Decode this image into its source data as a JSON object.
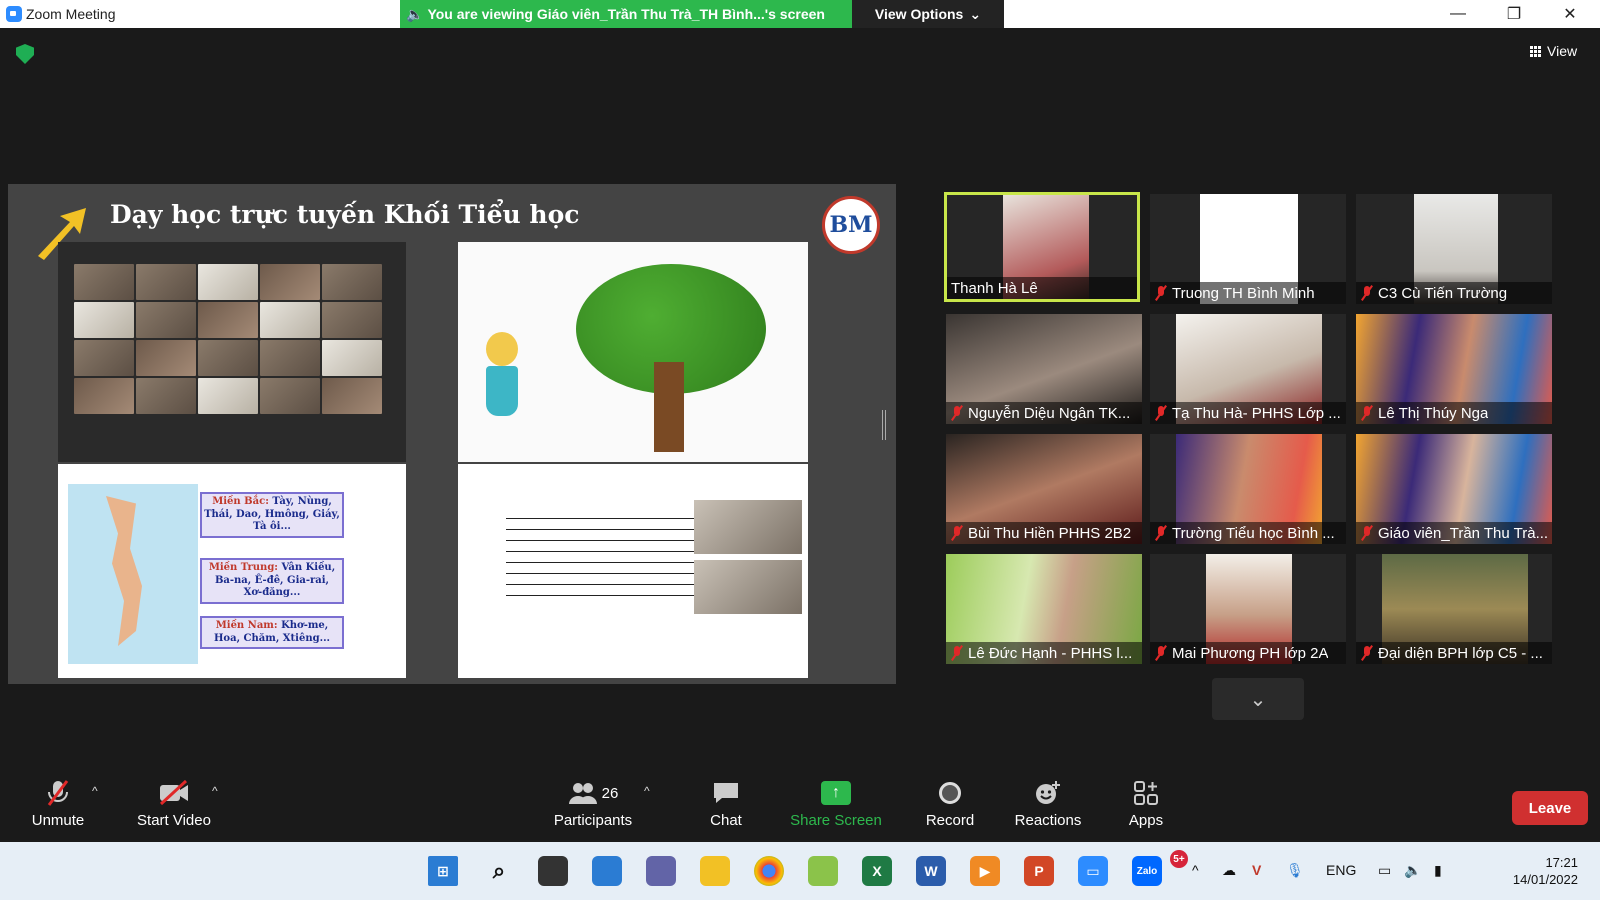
{
  "window": {
    "title": "Zoom Meeting",
    "viewing_banner": "You are viewing Giáo viên_Trần Thu Trà_TH Bình...'s screen",
    "view_options": "View Options"
  },
  "view_button": "View",
  "shared_screen": {
    "slide_title": "Dạy học trực tuyến Khối Tiểu học",
    "logo_text": "BM",
    "regions": [
      {
        "name": "Miền Bắc:",
        "text": "Tày, Nùng, Thái, Dao, Hmông, Giáy, Tà ôi..."
      },
      {
        "name": "Miền Trung:",
        "text": "Vân Kiều, Ba-na, Ê-đê, Gia-rai, Xơ-đăng..."
      },
      {
        "name": "Miền Nam:",
        "text": "Khơ-me, Hoa, Chăm, Xtiêng..."
      }
    ]
  },
  "participants": [
    {
      "name": "Thanh Hà Lê",
      "muted": false,
      "active": true
    },
    {
      "name": "Truong TH Bình Minh",
      "muted": true
    },
    {
      "name": "C3 Cù Tiến Trường",
      "muted": true
    },
    {
      "name": "Nguyễn Diệu Ngân TK...",
      "muted": true
    },
    {
      "name": "Tạ Thu Hà- PHHS Lớp ...",
      "muted": true
    },
    {
      "name": "Lê Thị Thúy Nga",
      "muted": true
    },
    {
      "name": "Bùi Thu Hiền PHHS 2B2",
      "muted": true
    },
    {
      "name": "Trường Tiểu học Bình ...",
      "muted": true
    },
    {
      "name": "Giáo viên_Trần Thu Trà...",
      "muted": true
    },
    {
      "name": "Lê Đức Hạnh - PHHS l...",
      "muted": true
    },
    {
      "name": "Mai Phương PH lớp 2A",
      "muted": true
    },
    {
      "name": "Đại diện BPH lớp C5 - ...",
      "muted": true
    }
  ],
  "toolbar": {
    "unmute": "Unmute",
    "start_video": "Start Video",
    "participants": "Participants",
    "participant_count": "26",
    "chat": "Chat",
    "share_screen": "Share Screen",
    "record": "Record",
    "reactions": "Reactions",
    "apps": "Apps",
    "leave": "Leave"
  },
  "taskbar": {
    "zalo_badge": "5+",
    "language": "ENG",
    "time": "17:21",
    "date": "14/01/2022"
  },
  "colors": {
    "banner_green": "#2db84d",
    "leave_red": "#d03030",
    "active_speaker": "#c8e64a",
    "zoom_blue": "#2d8cff"
  }
}
